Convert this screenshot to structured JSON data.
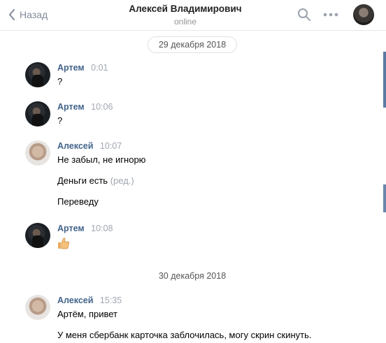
{
  "header": {
    "back_label": "Назад",
    "title": "Алексей Владимирович",
    "status": "online",
    "icons": [
      "chevron-left-icon",
      "search-icon",
      "more-icon"
    ]
  },
  "dates": [
    "29 декабря 2018",
    "30 декабря 2018"
  ],
  "messages": [
    {
      "name": "Артем",
      "time": "0:01",
      "lines": [
        "?"
      ]
    },
    {
      "name": "Артем",
      "time": "10:06",
      "lines": [
        "?"
      ]
    },
    {
      "name": "Алексей",
      "time": "10:07",
      "lines": [
        "Не забыл, не игнорю",
        "Деньги есть",
        "Переведу"
      ],
      "edited": "(ред.)"
    },
    {
      "name": "Артем",
      "time": "10:08",
      "lines": [],
      "sticker": "thumbs-up-icon"
    },
    {
      "name": "Алексей",
      "time": "15:35",
      "lines": [
        "Артём, привет",
        "У меня сбербанк карточка заблочилась, могу скрин скинуть."
      ]
    }
  ],
  "colors": {
    "name": "#42648b",
    "time": "#a0a6b0",
    "accent": "#5b7aa3"
  }
}
